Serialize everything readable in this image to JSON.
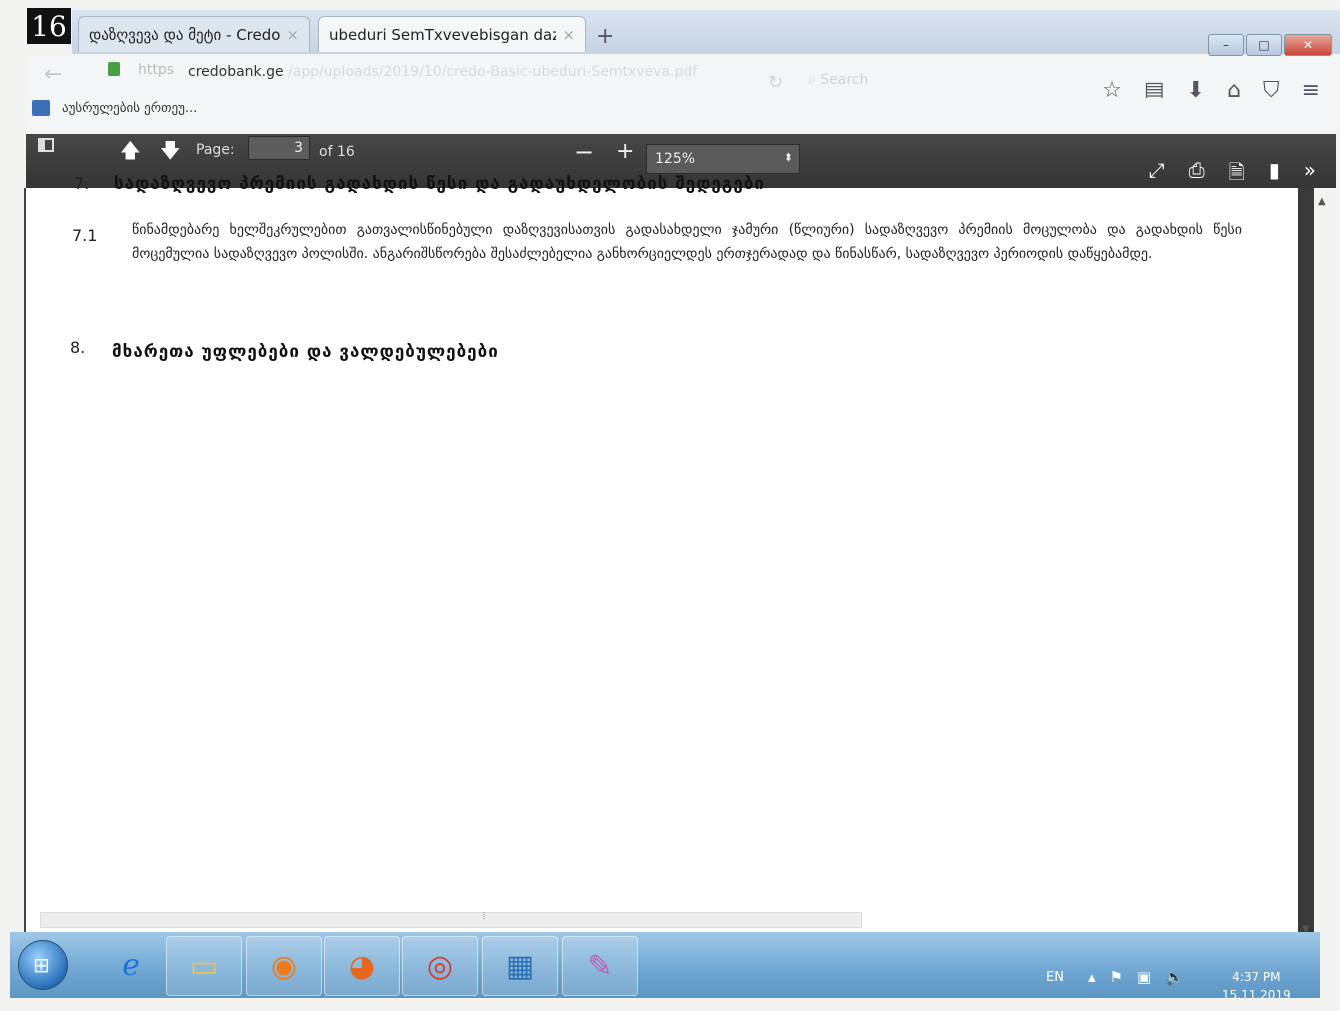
{
  "page_badge": "16",
  "browser": {
    "tabs": [
      {
        "label": "დაზღვევა და მეტი - Credo",
        "close": "×"
      },
      {
        "label": "ubeduri SemTxvevebisgan daz...",
        "close": "×"
      }
    ],
    "new_tab": "+",
    "window_controls": {
      "minimize": "–",
      "maximize": "□",
      "close": "✕"
    },
    "url_prefix": "https",
    "url_domain": "credobank.ge",
    "url_path": "/app/uploads/2019/10/credo-Basic-ubeduri-Semtxveva.pdf",
    "search_placeholder": "Search",
    "bookmark_label": "აუსრულების ერთეუ..."
  },
  "pdf_toolbar": {
    "page_label": "Page:",
    "page_value": "3",
    "page_count": "of 16",
    "zoom_value": "125%"
  },
  "document": {
    "section7_num": "7.",
    "section7_title": "სადაზღვევო პრემიის გადახდის წესი და გადაუხდელობის შედეგები",
    "clause71_num": "7.1",
    "clause71_text": "წინამდებარე ხელშეკრულებით გათვალისწინებული დაზღვევისათვის გადასახდელი ჯამური (წლიური) სადაზღვევო პრემიის მოცულობა და გადახდის წესი მოცემულია სადაზღვევო პოლისში. ანგარიშსწორება შესაძლებელია განხორციელდეს ერთჯერადად და წინასწარ, სადაზღვევო პერიოდის დაწყებამდე.",
    "section8_num": "8.",
    "section8_title": "მხარეთა უფლებები და ვალდებულებები"
  },
  "taskbar": {
    "lang": "EN",
    "time": "4:37 PM",
    "date": "15.11.2019"
  }
}
